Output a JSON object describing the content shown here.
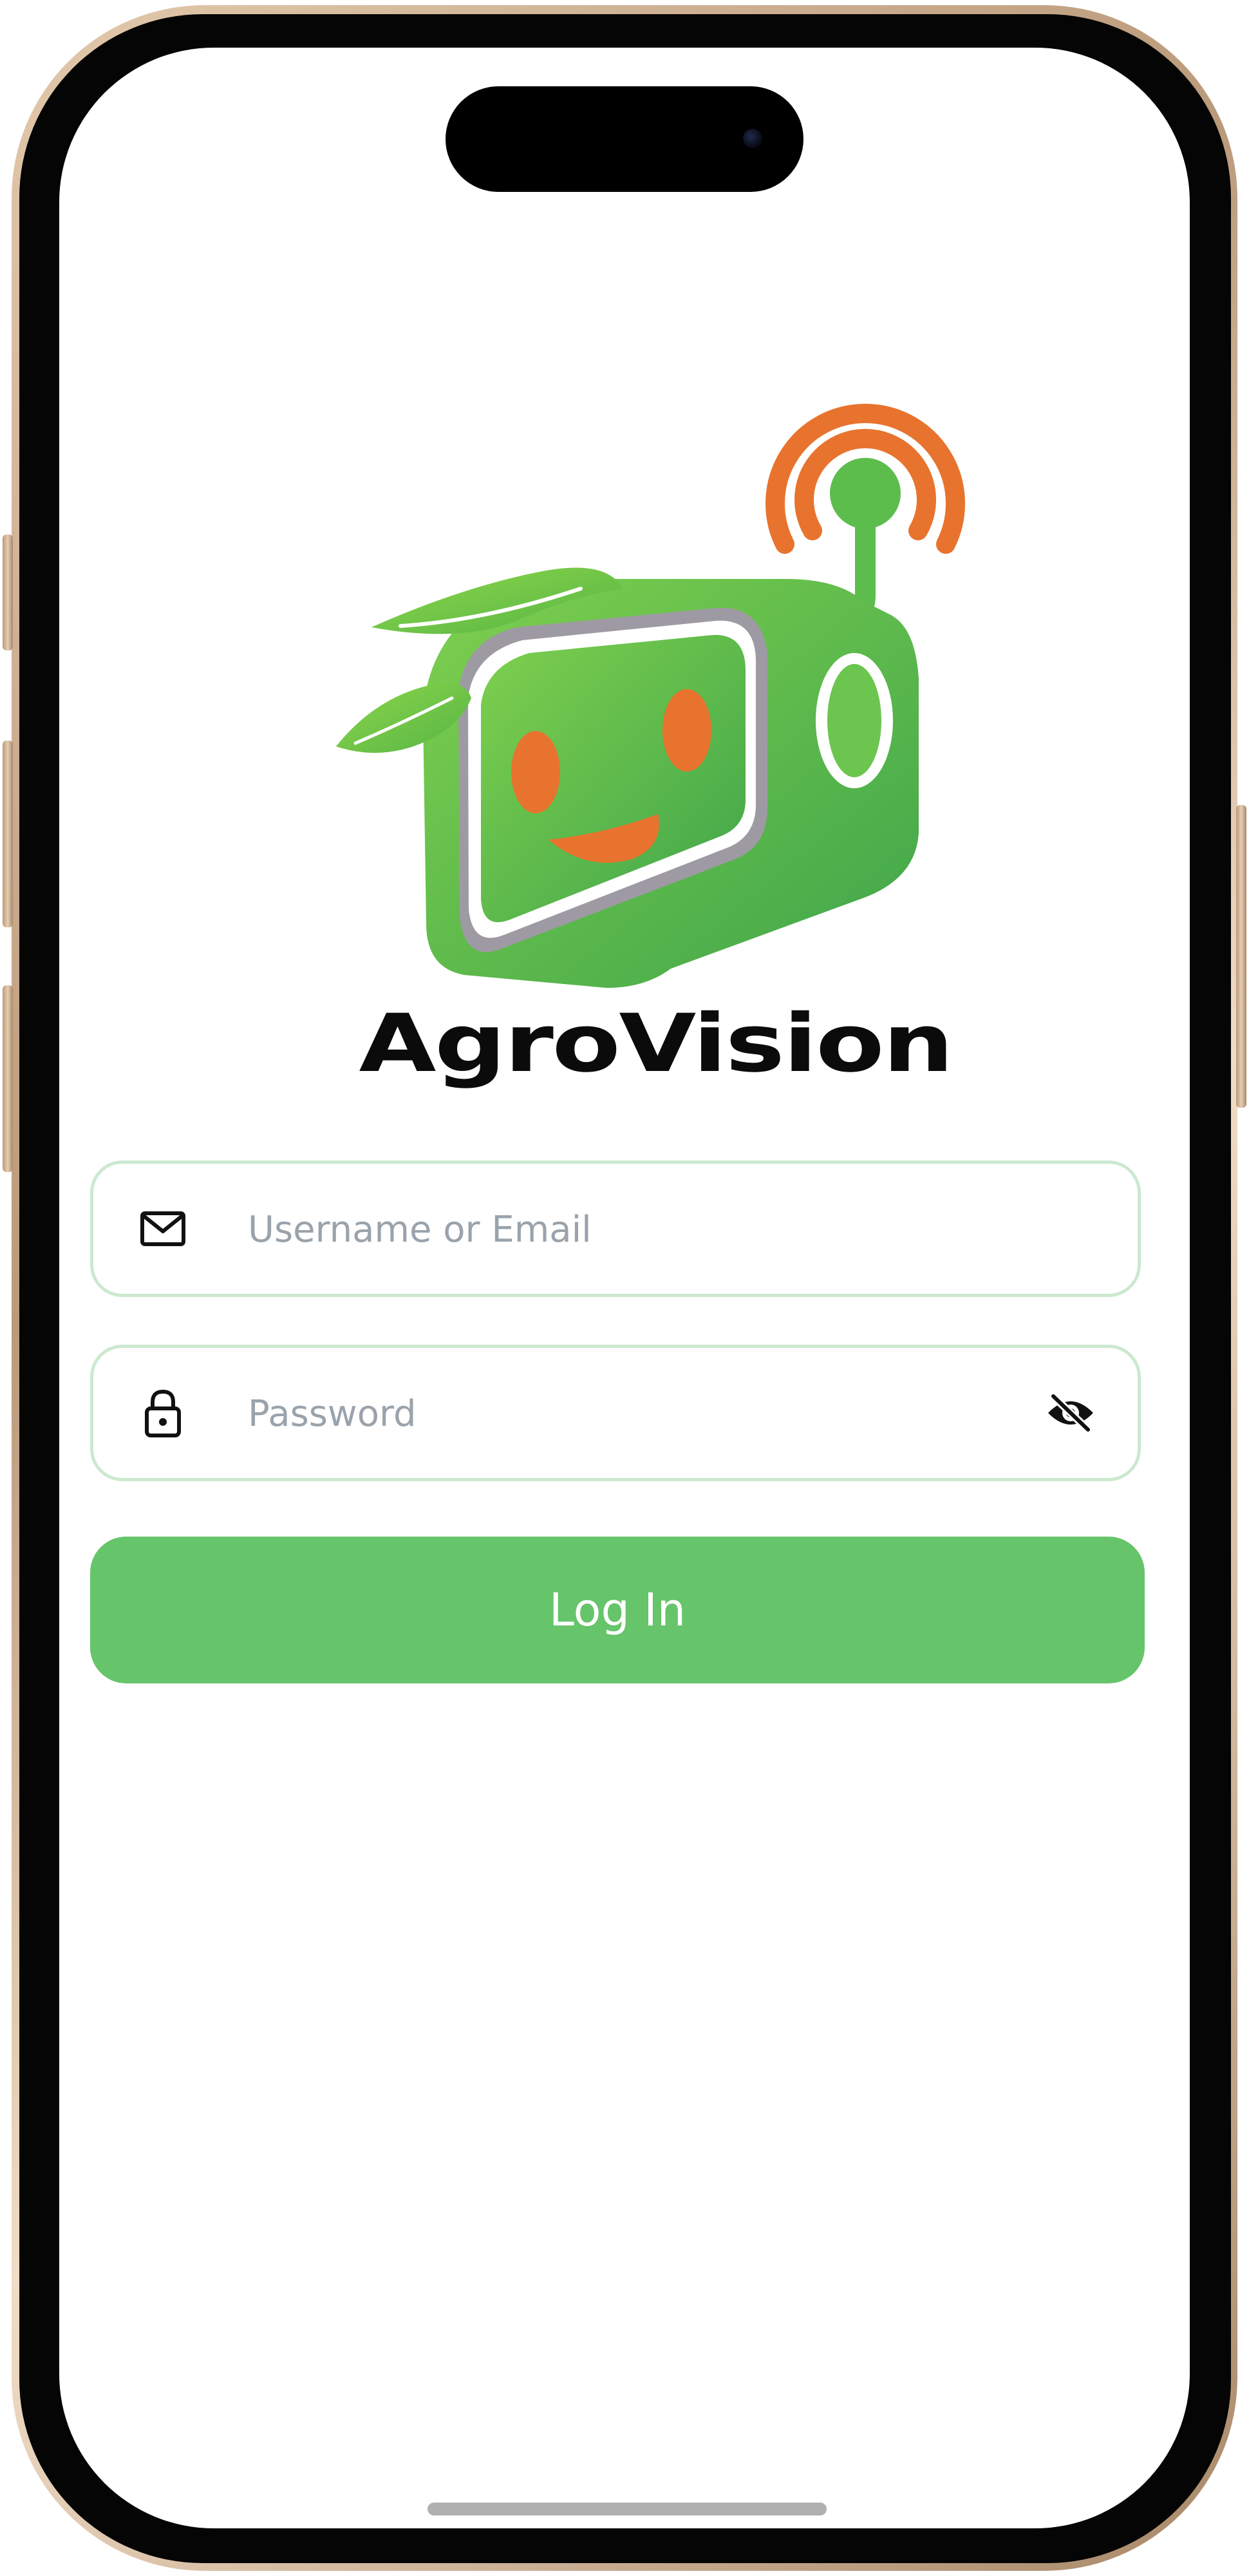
{
  "app": {
    "name": "AgroVision"
  },
  "login_form": {
    "username": {
      "placeholder": "Username or Email",
      "value": "",
      "icon": "mail-icon"
    },
    "password": {
      "placeholder": "Password",
      "value": "",
      "icon": "lock-icon",
      "toggle_icon": "eye-off-icon"
    },
    "submit_label": "Log In"
  },
  "colors": {
    "brand_green": "#66c46a",
    "field_border": "#cbe9cf",
    "accent_orange": "#e8732e",
    "text_dark": "#0b0b0b",
    "placeholder": "#9aa3ab"
  }
}
